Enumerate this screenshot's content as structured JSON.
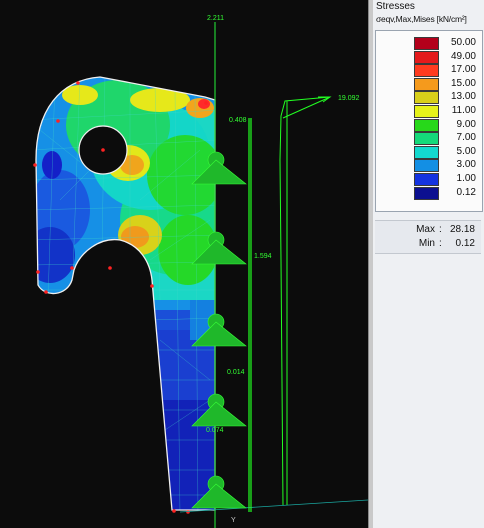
{
  "viewport": {
    "axis_top_label": "2.211",
    "axis_bottom_label": "Y",
    "load_max_label": "19.092",
    "dim_labels": [
      "0.408",
      "1.594",
      "0.014",
      "0.074"
    ],
    "colors": {
      "background": "#0c0c0c",
      "axis": "#22cc33",
      "load": "#22ff22",
      "outline": "#f0f0f0",
      "mesh": "#3fd8c8",
      "node": "#ff2222"
    }
  },
  "panel": {
    "title": "Stresses",
    "subtitle": "σeqv,Max,Mises [kN/cm²]",
    "legend": [
      {
        "value": "50.00",
        "color": "#b3001b"
      },
      {
        "value": "49.00",
        "color": "#e41a1c"
      },
      {
        "value": "17.00",
        "color": "#ff3b1f"
      },
      {
        "value": "15.00",
        "color": "#f59a1c"
      },
      {
        "value": "13.00",
        "color": "#d8cf1a"
      },
      {
        "value": "11.00",
        "color": "#e6f21a"
      },
      {
        "value": "9.00",
        "color": "#27d81a"
      },
      {
        "value": "7.00",
        "color": "#15d97a"
      },
      {
        "value": "5.00",
        "color": "#13d9cf"
      },
      {
        "value": "3.00",
        "color": "#138fe4"
      },
      {
        "value": "1.00",
        "color": "#1433e0"
      },
      {
        "value": "0.12",
        "color": "#0c1090"
      }
    ],
    "max_label": "Max",
    "max_value": "28.18",
    "min_label": "Min",
    "min_value": "0.12"
  }
}
